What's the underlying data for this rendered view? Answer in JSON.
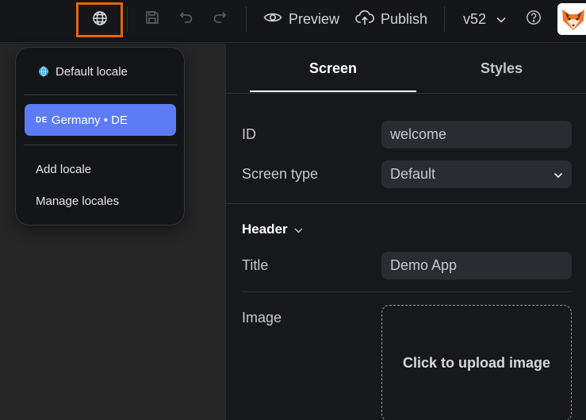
{
  "toolbar": {
    "preview_label": "Preview",
    "publish_label": "Publish",
    "version_label": "v52",
    "icons": [
      "globe-icon",
      "save-icon",
      "undo-icon",
      "redo-icon",
      "eye-icon",
      "cloud-upload-icon",
      "chevron-down-icon",
      "help-icon"
    ],
    "highlight_color": "#e8660f"
  },
  "locale_menu": {
    "default_label": "Default locale",
    "selected_code": "DE",
    "selected_label": "Germany • DE",
    "add_label": "Add locale",
    "manage_label": "Manage locales",
    "selected_color": "#5b7cf5"
  },
  "panel": {
    "tabs": [
      {
        "label": "Screen"
      },
      {
        "label": "Styles"
      }
    ],
    "id_label": "ID",
    "id_value": "welcome",
    "screen_type_label": "Screen type",
    "screen_type_value": "Default",
    "header_section": "Header",
    "title_label": "Title",
    "title_value": "Demo App",
    "image_label": "Image",
    "upload_text": "Click to upload image"
  }
}
